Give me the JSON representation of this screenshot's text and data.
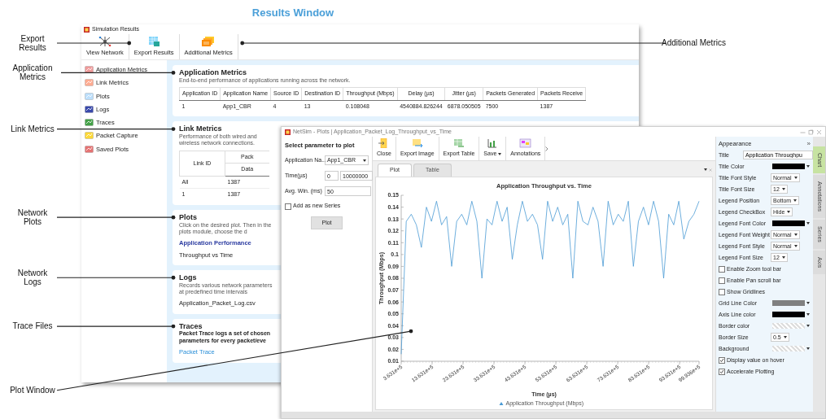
{
  "figure_title": "Results Window",
  "callouts": [
    {
      "label": "Export Results"
    },
    {
      "label": "Additional Metrics"
    },
    {
      "label": "Application Metrics"
    },
    {
      "label": "Link Metrics"
    },
    {
      "label": "Network Plots"
    },
    {
      "label": "Network Logs"
    },
    {
      "label": "Trace Files"
    },
    {
      "label": "Plot Window"
    }
  ],
  "results_window": {
    "title": "Simulation Results",
    "toolbar": [
      {
        "label": "View Network"
      },
      {
        "label": "Export Results"
      },
      {
        "label": "Additional Metrics"
      }
    ],
    "sidebar": [
      {
        "label": "Application Metrics"
      },
      {
        "label": "Link Metrics"
      },
      {
        "label": "Plots"
      },
      {
        "label": "Logs"
      },
      {
        "label": "Traces"
      },
      {
        "label": "Packet Capture"
      },
      {
        "label": "Saved Plots"
      }
    ],
    "sections": [
      {
        "kind": "table",
        "title": "Application Metrics",
        "description": "End-to-end performance of applications running across the network.",
        "columns": [
          "Application ID",
          "Application Name",
          "Source ID",
          "Destination ID",
          "Throughput (Mbps)",
          "Delay (µs)",
          "Jitter (µs)",
          "Packets Generated",
          "Packets Receive"
        ],
        "rows": [
          [
            "1",
            "App1_CBR",
            "4",
            "13",
            "0.108048",
            "4540884.826244",
            "6878.050505",
            "7500",
            "1387"
          ]
        ]
      },
      {
        "kind": "grouped_table",
        "title": "Link Metrics",
        "description": "Performance of both wired and wireless network connections.",
        "row_header": "Link ID",
        "group": "Pack",
        "subcolumns": [
          "Data"
        ],
        "rows": [
          [
            "All",
            "1387"
          ],
          [
            "1",
            "1387"
          ]
        ]
      },
      {
        "kind": "list",
        "title": "Plots",
        "description": "Click on the desired plot. Then in the plots module, choose the d",
        "heading": "Application Performance",
        "items": [
          {
            "text": "Throughput vs Time",
            "link": false
          }
        ]
      },
      {
        "kind": "list",
        "title": "Logs",
        "description": "Records various network parameters at predefined time intervals",
        "items": [
          {
            "text": "Application_Packet_Log.csv",
            "link": false
          }
        ]
      },
      {
        "kind": "list",
        "title": "Traces",
        "description": "Packet Trace logs a set of chosen parameters for every packet/eve",
        "items": [
          {
            "text": "Packet Trace",
            "link": true
          }
        ]
      }
    ]
  },
  "plot_window": {
    "title": "NetSim - Plots | Application_Packet_Log_Throughput_vs_Time",
    "parameters": {
      "heading": "Select parameter to plot",
      "fields": [
        {
          "kind": "select",
          "label": "Application Na...",
          "value": "App1_CBR"
        },
        {
          "kind": "range",
          "label": "Time(µs)",
          "values": [
            "0",
            "10000000"
          ]
        },
        {
          "kind": "input",
          "label": "Avg. Win. (ms)",
          "value": "50"
        },
        {
          "kind": "checkbox",
          "label": "Add as new Series",
          "checked": false
        }
      ],
      "button": "Plot"
    },
    "toolbar": [
      {
        "label": "Close",
        "dropdown": false
      },
      {
        "label": "Export Image",
        "dropdown": false
      },
      {
        "label": "Export Table",
        "dropdown": false
      },
      {
        "label": "Save",
        "dropdown": true
      },
      {
        "label": "Annotations",
        "dropdown": false
      }
    ],
    "tabs": [
      {
        "label": "Plot",
        "selected": true
      },
      {
        "label": "Table",
        "selected": false
      }
    ],
    "chart_data": {
      "type": "line",
      "title": "Application Throughput vs. Time",
      "xlabel": "Time (µs)",
      "ylabel": "Throughput (Mbps)",
      "x": [
        363100,
        526300,
        689500,
        852700,
        1015900,
        1179100,
        1342300,
        1505500,
        1668700,
        1831900,
        1995100,
        2158300,
        2321500,
        2484700,
        2647900,
        2811100,
        2974300,
        3137500,
        3300700,
        3463900,
        3627100,
        3790300,
        3953500,
        4116700,
        4279900,
        4443100,
        4606300,
        4769500,
        4932700,
        5095900,
        5259100,
        5422300,
        5585500,
        5748700,
        5911900,
        6075100,
        6238300,
        6401500,
        6564700,
        6727900,
        6891100,
        7054300,
        7217500,
        7380700,
        7543900,
        7707100,
        7870300,
        8033500,
        8196700,
        8359900,
        8523100,
        8686300,
        8849500,
        9012700,
        9175900,
        9339100,
        9502300,
        9665500,
        9828700,
        9993600
      ],
      "series": [
        {
          "name": "Application Throughput (Mbps)",
          "color": "#4a9ad4",
          "values": [
            0.016,
            0.128,
            0.134,
            0.125,
            0.106,
            0.14,
            0.128,
            0.145,
            0.125,
            0.132,
            0.09,
            0.128,
            0.134,
            0.125,
            0.145,
            0.128,
            0.08,
            0.13,
            0.125,
            0.145,
            0.128,
            0.14,
            0.096,
            0.125,
            0.145,
            0.128,
            0.134,
            0.125,
            0.096,
            0.145,
            0.128,
            0.14,
            0.125,
            0.134,
            0.08,
            0.145,
            0.128,
            0.125,
            0.14,
            0.128,
            0.09,
            0.145,
            0.125,
            0.134,
            0.128,
            0.145,
            0.09,
            0.128,
            0.14,
            0.125,
            0.145,
            0.128,
            0.08,
            0.134,
            0.125,
            0.145,
            0.113,
            0.128,
            0.134,
            0.145
          ]
        }
      ],
      "xlim": [
        363100,
        9993600
      ],
      "ylim": [
        0.01,
        0.15
      ],
      "xticks": [
        {
          "value": 363100,
          "label": "3.631e+5"
        },
        {
          "value": 1363100,
          "label": "13.631e+5"
        },
        {
          "value": 2363100,
          "label": "23.631e+5"
        },
        {
          "value": 3363100,
          "label": "33.631e+5"
        },
        {
          "value": 4363100,
          "label": "43.631e+5"
        },
        {
          "value": 5363100,
          "label": "53.631e+5"
        },
        {
          "value": 6363100,
          "label": "63.631e+5"
        },
        {
          "value": 7363100,
          "label": "73.631e+5"
        },
        {
          "value": 8363100,
          "label": "83.631e+5"
        },
        {
          "value": 9363100,
          "label": "93.631e+5"
        },
        {
          "value": 9993600,
          "label": "99.936e+5"
        }
      ],
      "yticks": [
        0.01,
        0.02,
        0.03,
        0.04,
        0.05,
        0.06,
        0.07,
        0.08,
        0.09,
        0.1,
        0.11,
        0.12,
        0.13,
        0.14,
        0.15
      ]
    },
    "appearance": {
      "title": "Appearance",
      "collapse": "»",
      "properties": [
        {
          "kind": "text",
          "label": "Title",
          "value": "Application Throughpu"
        },
        {
          "kind": "color",
          "label": "Title Color",
          "color": "#000000"
        },
        {
          "kind": "select",
          "label": "Title Font Style",
          "value": "Normal"
        },
        {
          "kind": "select",
          "label": "Title Font Size",
          "value": "12"
        },
        {
          "kind": "select",
          "label": "Legend Position",
          "value": "Bottom"
        },
        {
          "kind": "select",
          "label": "Legend CheckBox",
          "value": "Hide"
        },
        {
          "kind": "color",
          "label": "Legend Font Color",
          "color": "#000000"
        },
        {
          "kind": "select",
          "label": "Legend Font Weight",
          "value": "Normal"
        },
        {
          "kind": "select",
          "label": "Legend Font Style",
          "value": "Normal"
        },
        {
          "kind": "select",
          "label": "Legend Font Size",
          "value": "12"
        },
        {
          "kind": "checkbox",
          "label": "Enable Zoom tool bar",
          "checked": false
        },
        {
          "kind": "checkbox",
          "label": "Enable Pan scroll bar",
          "checked": false
        },
        {
          "kind": "checkbox",
          "label": "Show Gridlines",
          "checked": false
        },
        {
          "kind": "color",
          "label": "Grid Line Color",
          "color": "#808080"
        },
        {
          "kind": "color",
          "label": "Axis Line color",
          "color": "#000000"
        },
        {
          "kind": "empty_color",
          "label": "Border color"
        },
        {
          "kind": "select",
          "label": "Border Size",
          "value": "0.5"
        },
        {
          "kind": "empty_color",
          "label": "Background"
        },
        {
          "kind": "checkbox",
          "label": "Display value on hover",
          "checked": true
        },
        {
          "kind": "checkbox",
          "label": "Accelerate Plotting",
          "checked": true
        }
      ]
    },
    "side_tabs": [
      {
        "label": "Chart",
        "selected": true
      },
      {
        "label": "Annotations",
        "selected": false
      },
      {
        "label": "Series",
        "selected": false
      },
      {
        "label": "Axis",
        "selected": false
      }
    ]
  }
}
